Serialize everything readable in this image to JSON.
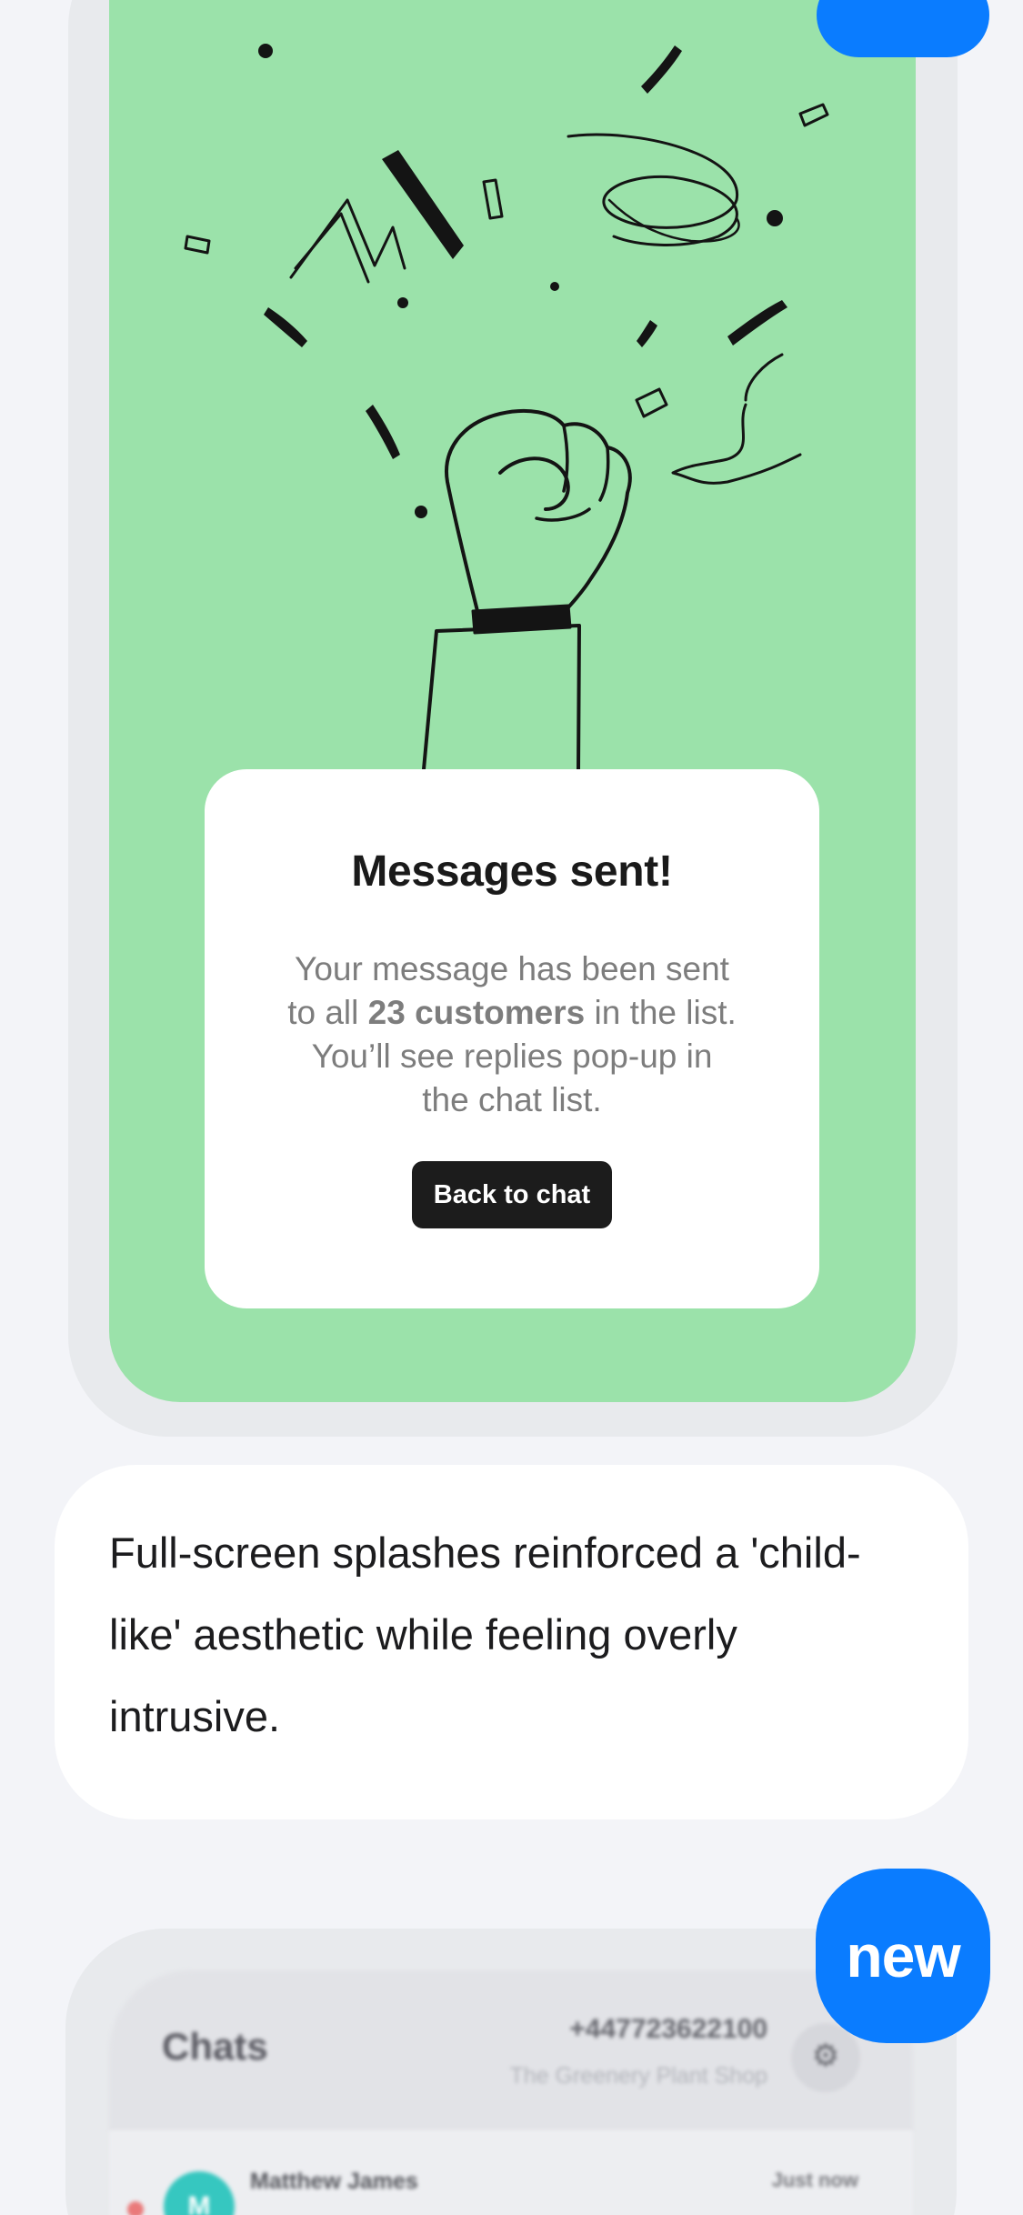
{
  "modal": {
    "title": "Messages sent!",
    "body_line1": "Your message has been sent",
    "body_prefix": "to all ",
    "body_bold": "23 customers",
    "body_suffix": " in the list.",
    "body_line3": "You’ll see replies pop-up in",
    "body_line4": "the chat list.",
    "button_label": "Back to chat"
  },
  "caption": {
    "text": "Full-screen splashes reinforced a 'child-like' aesthetic while feeling overly intrusive."
  },
  "badge": {
    "label": "new"
  },
  "chats_preview": {
    "title": "Chats",
    "phone_number": "+447723622100",
    "shop_name": "The Greenery Plant Shop",
    "settings_icon": "gear-icon",
    "items": [
      {
        "avatar_initial": "M",
        "name": "Matthew James",
        "time": "Just now",
        "unread": true
      }
    ]
  },
  "colors": {
    "page_background": "#f3f4f8",
    "splash_green": "#9be2aa",
    "accent_blue": "#0a7cff",
    "button_dark": "#1c1c1c",
    "avatar_teal": "#36c7c0",
    "unread_red": "#ea7a7a"
  }
}
